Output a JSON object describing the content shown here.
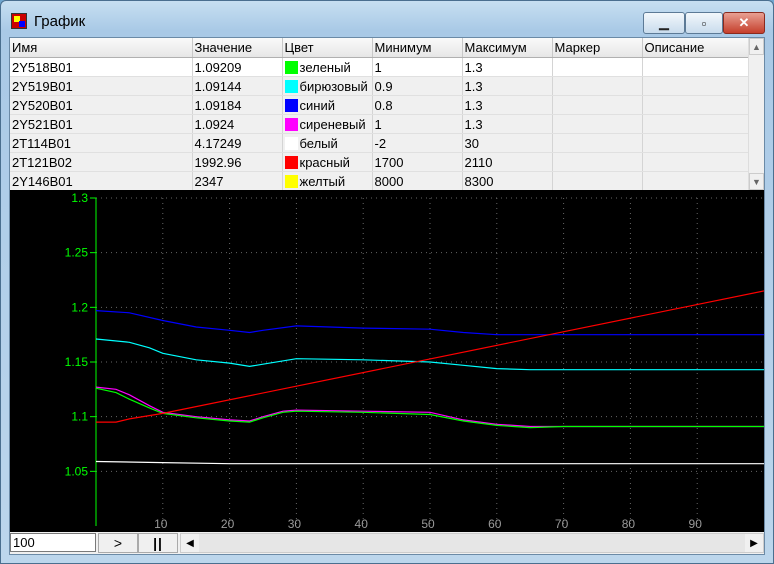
{
  "window": {
    "title": "График"
  },
  "table": {
    "headers": [
      "Имя",
      "Значение",
      "Цвет",
      "Минимум",
      "Максимум",
      "Маркер",
      "Описание"
    ],
    "rows": [
      {
        "name": "2Y518B01",
        "value": "1.09209",
        "color_name": "зеленый",
        "color": "#00ff00",
        "min": "1",
        "max": "1.3",
        "marker": "",
        "description": ""
      },
      {
        "name": "2Y519B01",
        "value": "1.09144",
        "color_name": "бирюзовый",
        "color": "#00ffff",
        "min": "0.9",
        "max": "1.3",
        "marker": "",
        "description": ""
      },
      {
        "name": "2Y520B01",
        "value": "1.09184",
        "color_name": "синий",
        "color": "#0000ff",
        "min": "0.8",
        "max": "1.3",
        "marker": "",
        "description": ""
      },
      {
        "name": "2Y521B01",
        "value": "1.0924",
        "color_name": "сиреневый",
        "color": "#ff00ff",
        "min": "1",
        "max": "1.3",
        "marker": "",
        "description": ""
      },
      {
        "name": "2T114B01",
        "value": "4.17249",
        "color_name": "белый",
        "color": "#ffffff",
        "min": "-2",
        "max": "30",
        "marker": "",
        "description": ""
      },
      {
        "name": "2T121B02",
        "value": "1992.96",
        "color_name": "красный",
        "color": "#ff0000",
        "min": "1700",
        "max": "2110",
        "marker": "",
        "description": ""
      },
      {
        "name": "2Y146B01",
        "value": "2347",
        "color_name": "желтый",
        "color": "#ffff00",
        "min": "8000",
        "max": "8300",
        "marker": "",
        "description": ""
      }
    ]
  },
  "bottom": {
    "scale_value": "100",
    "play_label": ">",
    "pause_label": "||"
  },
  "chart_data": {
    "type": "line",
    "ylim": [
      1.0,
      1.3
    ],
    "xlim": [
      0,
      100
    ],
    "grid": true,
    "y_ticks": [
      "1.05",
      "1.1",
      "1.15",
      "1.2",
      "1.25",
      "1.3"
    ],
    "x_ticks": [
      "10",
      "20",
      "30",
      "40",
      "50",
      "60",
      "70",
      "80",
      "90"
    ],
    "axis_color": "#00ff00",
    "series": [
      {
        "color": "#0000ff",
        "x": [
          0,
          5,
          10,
          15,
          20,
          23,
          25,
          30,
          40,
          50,
          55,
          60,
          65,
          70,
          80,
          90,
          100
        ],
        "y": [
          1.197,
          1.195,
          1.188,
          1.182,
          1.179,
          1.177,
          1.179,
          1.183,
          1.181,
          1.18,
          1.177,
          1.175,
          1.175,
          1.175,
          1.175,
          1.175,
          1.175
        ]
      },
      {
        "color": "#00ffff",
        "x": [
          0,
          5,
          8,
          10,
          15,
          20,
          23,
          25,
          30,
          40,
          50,
          55,
          60,
          65,
          70,
          80,
          90,
          100
        ],
        "y": [
          1.171,
          1.168,
          1.163,
          1.158,
          1.152,
          1.149,
          1.146,
          1.148,
          1.153,
          1.152,
          1.15,
          1.147,
          1.144,
          1.143,
          1.143,
          1.143,
          1.143,
          1.143
        ]
      },
      {
        "color": "#ff00ff",
        "x": [
          0,
          3,
          5,
          8,
          10,
          15,
          20,
          23,
          25,
          28,
          30,
          40,
          50,
          55,
          60,
          65,
          70,
          80,
          90,
          100
        ],
        "y": [
          1.127,
          1.125,
          1.12,
          1.11,
          1.104,
          1.1,
          1.097,
          1.096,
          1.1,
          1.105,
          1.106,
          1.105,
          1.104,
          1.097,
          1.093,
          1.091,
          1.091,
          1.091,
          1.091,
          1.091
        ]
      },
      {
        "color": "#00ff00",
        "x": [
          0,
          3,
          5,
          8,
          10,
          15,
          20,
          23,
          25,
          28,
          30,
          40,
          50,
          55,
          60,
          65,
          70,
          80,
          90,
          100
        ],
        "y": [
          1.126,
          1.122,
          1.116,
          1.108,
          1.103,
          1.099,
          1.096,
          1.095,
          1.099,
          1.104,
          1.105,
          1.104,
          1.102,
          1.096,
          1.092,
          1.09,
          1.091,
          1.091,
          1.091,
          1.091
        ]
      },
      {
        "color": "#ffffff",
        "x": [
          0,
          10,
          20,
          40,
          60,
          80,
          100
        ],
        "y": [
          1.059,
          1.058,
          1.057,
          1.057,
          1.057,
          1.057,
          1.057
        ]
      },
      {
        "color": "#ff0000",
        "x": [
          0,
          3,
          5,
          10,
          100
        ],
        "y": [
          1.095,
          1.095,
          1.098,
          1.103,
          1.215
        ]
      }
    ]
  }
}
